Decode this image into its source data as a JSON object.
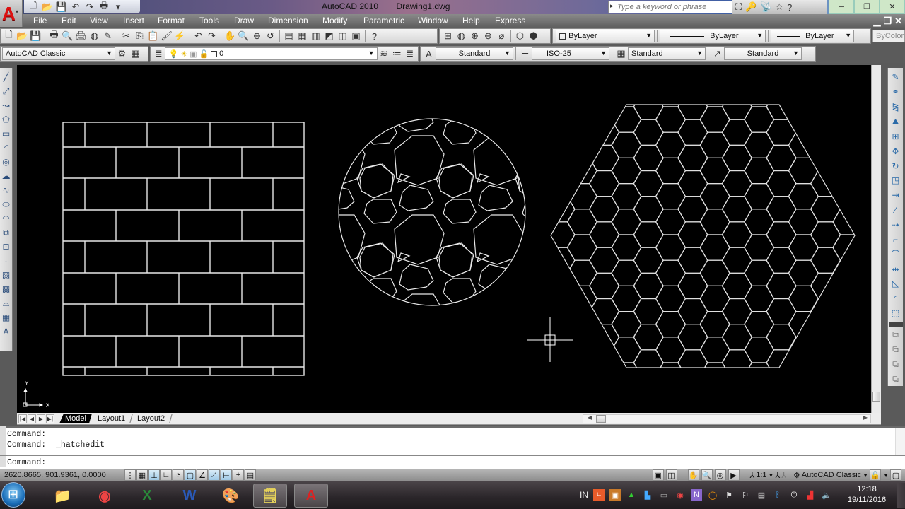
{
  "window": {
    "app_name": "AutoCAD 2010",
    "document": "Drawing1.dwg",
    "search_placeholder": "Type a keyword or phrase",
    "controls": {
      "minimize": "─",
      "restore": "❐",
      "close": "✕"
    }
  },
  "quick_access": [
    {
      "icon": "new-icon",
      "glyph": "🗋"
    },
    {
      "icon": "open-icon",
      "glyph": "📂"
    },
    {
      "icon": "save-icon",
      "glyph": "💾"
    },
    {
      "icon": "undo-icon",
      "glyph": "↶"
    },
    {
      "icon": "redo-icon",
      "glyph": "↷"
    },
    {
      "icon": "print-icon",
      "glyph": "🖶"
    },
    {
      "icon": "dropdown-icon",
      "glyph": "▾"
    }
  ],
  "menu": [
    "File",
    "Edit",
    "View",
    "Insert",
    "Format",
    "Tools",
    "Draw",
    "Dimension",
    "Modify",
    "Parametric",
    "Window",
    "Help",
    "Express"
  ],
  "menu_positions_note": "",
  "infocenter": [
    {
      "icon": "binoculars-icon",
      "glyph": "⛶"
    },
    {
      "icon": "key-icon",
      "glyph": "🔑"
    },
    {
      "icon": "satellite-icon",
      "glyph": "📡"
    },
    {
      "icon": "favorites-icon",
      "glyph": "☆"
    },
    {
      "icon": "help-icon",
      "glyph": "?"
    }
  ],
  "toolbar1": {
    "standard_icons": [
      {
        "icon": "qnew-icon",
        "glyph": "🗋"
      },
      {
        "icon": "open-icon",
        "glyph": "📂"
      },
      {
        "icon": "save-icon",
        "glyph": "💾"
      },
      {
        "icon": "plot-icon",
        "glyph": "🖶"
      },
      {
        "icon": "plot-preview-icon",
        "glyph": "🔍"
      },
      {
        "icon": "publish-icon",
        "glyph": "🖨"
      },
      {
        "icon": "3dprint-icon",
        "glyph": "◍"
      },
      {
        "icon": "etransmit-icon",
        "glyph": "✎"
      },
      {
        "icon": "cut-icon",
        "glyph": "✂"
      },
      {
        "icon": "copy-icon",
        "glyph": "⎘"
      },
      {
        "icon": "paste-icon",
        "glyph": "📋"
      },
      {
        "icon": "match-properties-icon",
        "glyph": "🖌"
      },
      {
        "icon": "block-editor-icon",
        "glyph": "⚡"
      },
      {
        "icon": "undo-icon",
        "glyph": "↶"
      },
      {
        "icon": "redo-icon",
        "glyph": "↷"
      },
      {
        "icon": "pan-icon",
        "glyph": "✋"
      },
      {
        "icon": "zoom-realtime-icon",
        "glyph": "🔍"
      },
      {
        "icon": "zoom-window-icon",
        "glyph": "⊕"
      },
      {
        "icon": "zoom-previous-icon",
        "glyph": "↺"
      },
      {
        "icon": "properties-icon",
        "glyph": "▤"
      },
      {
        "icon": "design-center-icon",
        "glyph": "▦"
      },
      {
        "icon": "tool-palettes-icon",
        "glyph": "▥"
      },
      {
        "icon": "sheet-set-icon",
        "glyph": "◩"
      },
      {
        "icon": "markup-icon",
        "glyph": "◫"
      },
      {
        "icon": "calculator-icon",
        "glyph": "▣"
      },
      {
        "icon": "help-icon",
        "glyph": "?"
      }
    ],
    "view_icons": [
      {
        "icon": "viewport-icon",
        "glyph": "⊞"
      },
      {
        "icon": "sphere-icon",
        "glyph": "◍"
      },
      {
        "icon": "add-sphere-icon",
        "glyph": "⊕"
      },
      {
        "icon": "remove-sphere-icon",
        "glyph": "⊖"
      },
      {
        "icon": "no-sphere-icon",
        "glyph": "⌀"
      },
      {
        "icon": "3d-box-icon",
        "glyph": "⬡"
      },
      {
        "icon": "3d-remove-icon",
        "glyph": "⬢"
      }
    ],
    "color_value": "ByLayer",
    "linetype_value": "ByLayer",
    "lineweight_value": "ByLayer",
    "plotstyle_value": "ByColor"
  },
  "toolbar2": {
    "workspace_value": "AutoCAD Classic",
    "layer_value": "0",
    "text_style_value": "Standard",
    "dim_style_value": "ISO-25",
    "table_style_value": "Standard",
    "multileader_style_value": "Standard"
  },
  "draw_toolbar": [
    {
      "icon": "line-icon",
      "glyph": "╱"
    },
    {
      "icon": "construction-line-icon",
      "glyph": "⤢"
    },
    {
      "icon": "polyline-icon",
      "glyph": "↝"
    },
    {
      "icon": "polygon-icon",
      "glyph": "⬠"
    },
    {
      "icon": "rectangle-icon",
      "glyph": "▭"
    },
    {
      "icon": "arc-icon",
      "glyph": "◜"
    },
    {
      "icon": "circle-icon",
      "glyph": "◎"
    },
    {
      "icon": "revision-cloud-icon",
      "glyph": "☁"
    },
    {
      "icon": "spline-icon",
      "glyph": "∿"
    },
    {
      "icon": "ellipse-icon",
      "glyph": "⬭"
    },
    {
      "icon": "ellipse-arc-icon",
      "glyph": "◠"
    },
    {
      "icon": "insert-block-icon",
      "glyph": "⧉"
    },
    {
      "icon": "make-block-icon",
      "glyph": "⊡"
    },
    {
      "icon": "point-icon",
      "glyph": "·"
    },
    {
      "icon": "hatch-icon",
      "glyph": "▨"
    },
    {
      "icon": "gradient-icon",
      "glyph": "▩"
    },
    {
      "icon": "region-icon",
      "glyph": "⌓"
    },
    {
      "icon": "table-icon",
      "glyph": "▦"
    },
    {
      "icon": "multiline-text-icon",
      "glyph": "A"
    }
  ],
  "modify_toolbar": [
    {
      "icon": "erase-icon",
      "glyph": "✎"
    },
    {
      "icon": "copy-object-icon",
      "glyph": "⚭"
    },
    {
      "icon": "mirror-icon",
      "glyph": "⧎"
    },
    {
      "icon": "offset-icon",
      "glyph": "⛰"
    },
    {
      "icon": "array-icon",
      "glyph": "⊞"
    },
    {
      "icon": "move-icon",
      "glyph": "✥"
    },
    {
      "icon": "rotate-icon",
      "glyph": "↻"
    },
    {
      "icon": "scale-icon",
      "glyph": "◳"
    },
    {
      "icon": "stretch-icon",
      "glyph": "⇥"
    },
    {
      "icon": "trim-icon",
      "glyph": "⁄"
    },
    {
      "icon": "extend-icon",
      "glyph": "⇢"
    },
    {
      "icon": "break-at-point-icon",
      "glyph": "⌐"
    },
    {
      "icon": "break-icon",
      "glyph": "⌒"
    },
    {
      "icon": "join-icon",
      "glyph": "⇹"
    },
    {
      "icon": "chamfer-icon",
      "glyph": "◺"
    },
    {
      "icon": "fillet-icon",
      "glyph": "◜"
    },
    {
      "icon": "explode-icon",
      "glyph": "⬚"
    }
  ],
  "draworder_toolbar": [
    {
      "icon": "bring-to-front-icon",
      "glyph": "⧉"
    },
    {
      "icon": "send-to-back-icon",
      "glyph": "⧉"
    },
    {
      "icon": "bring-above-icon",
      "glyph": "⧉"
    },
    {
      "icon": "send-under-icon",
      "glyph": "⧉"
    }
  ],
  "drawing": {
    "hatches": [
      {
        "name": "brick-hatch",
        "pattern": "AR-B816",
        "boundary": "rectangle"
      },
      {
        "name": "stone-hatch",
        "pattern": "GRAVEL",
        "boundary": "circle"
      },
      {
        "name": "hexagon-hatch",
        "pattern": "HONEY",
        "boundary": "hexagon"
      }
    ],
    "ucs": {
      "x_label": "X",
      "y_label": "Y"
    }
  },
  "layout_tabs": [
    {
      "label": "Model",
      "active": true
    },
    {
      "label": "Layout1",
      "active": false
    },
    {
      "label": "Layout2",
      "active": false
    }
  ],
  "command_history": [
    "Command:",
    "Command:  _hatchedit"
  ],
  "command_prompt": "Command:",
  "status": {
    "coordinates": "2620.8665, 901.9361, 0.0000",
    "toggles": [
      {
        "name": "infer-constraints",
        "glyph": "⋮",
        "on": false
      },
      {
        "name": "snap",
        "glyph": "▦",
        "on": false
      },
      {
        "name": "grid",
        "glyph": "⊥",
        "on": true
      },
      {
        "name": "ortho",
        "glyph": "∟",
        "on": false
      },
      {
        "name": "polar",
        "glyph": "◔",
        "on": false
      },
      {
        "name": "osnap",
        "glyph": "▢",
        "on": true
      },
      {
        "name": "3dosnap",
        "glyph": "∠",
        "on": false
      },
      {
        "name": "otrack",
        "glyph": "⟋",
        "on": true
      },
      {
        "name": "ducs",
        "glyph": "⊢",
        "on": true
      },
      {
        "name": "dyn",
        "glyph": "+",
        "on": false
      },
      {
        "name": "lwt",
        "glyph": "▤",
        "on": false
      }
    ],
    "annotation_scale": "1:1",
    "workspace": "AutoCAD Classic"
  },
  "taskbar": {
    "apps": [
      {
        "name": "explorer",
        "glyph": "📁"
      },
      {
        "name": "chrome",
        "glyph": "◉"
      },
      {
        "name": "excel",
        "glyph": "X"
      },
      {
        "name": "word",
        "glyph": "W"
      },
      {
        "name": "paint",
        "glyph": "🎨"
      },
      {
        "name": "sticky-notes",
        "glyph": "🗒"
      },
      {
        "name": "autocad",
        "glyph": "A"
      }
    ],
    "language": "IN",
    "time": "12:18",
    "date": "19/11/2016"
  }
}
